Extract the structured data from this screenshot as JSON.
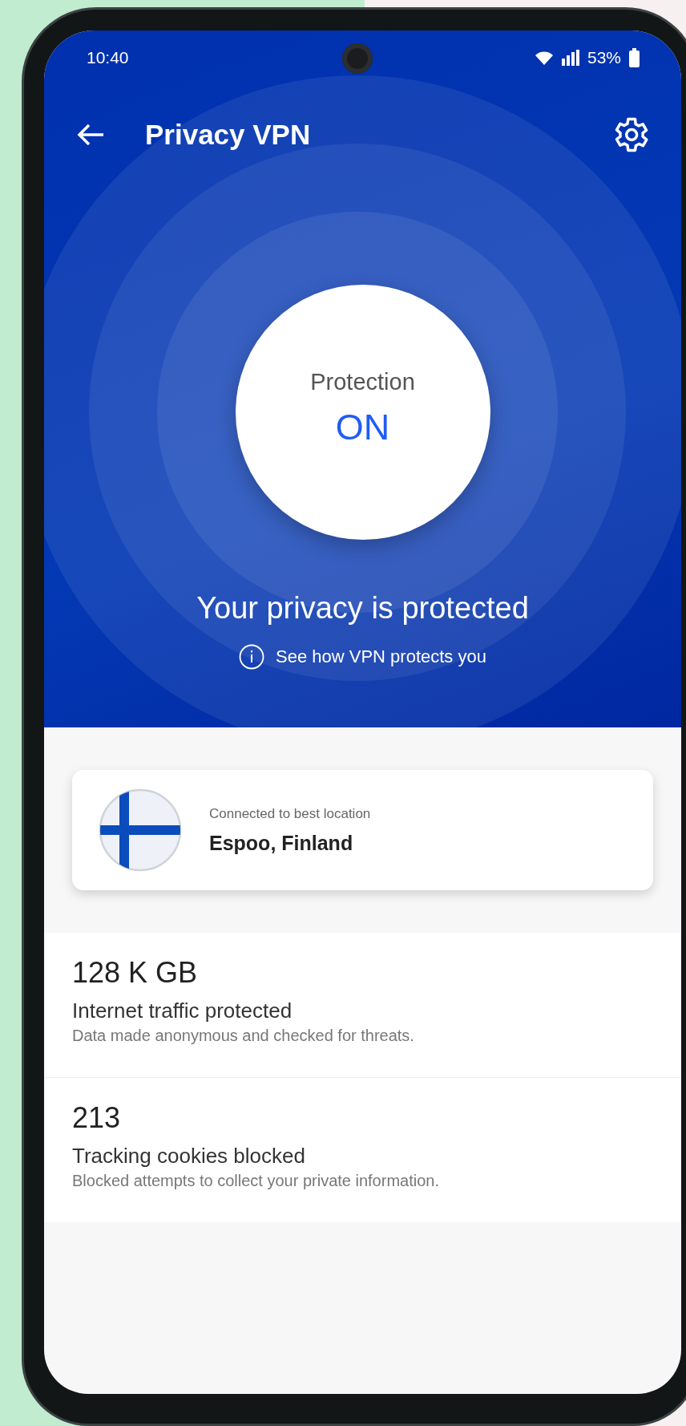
{
  "status_bar": {
    "time": "10:40",
    "battery": "53%"
  },
  "app_bar": {
    "title": "Privacy VPN"
  },
  "protection": {
    "label": "Protection",
    "state": "ON"
  },
  "headline": "Your privacy is protected",
  "info_link": "See how VPN protects you",
  "location": {
    "caption": "Connected to best location",
    "name": "Espoo, Finland"
  },
  "stats": [
    {
      "value": "128 K GB",
      "label": "Internet traffic protected",
      "description": "Data made anonymous and checked for threats."
    },
    {
      "value": "213",
      "label": "Tracking cookies blocked",
      "description": "Blocked attempts to collect your private information."
    }
  ]
}
